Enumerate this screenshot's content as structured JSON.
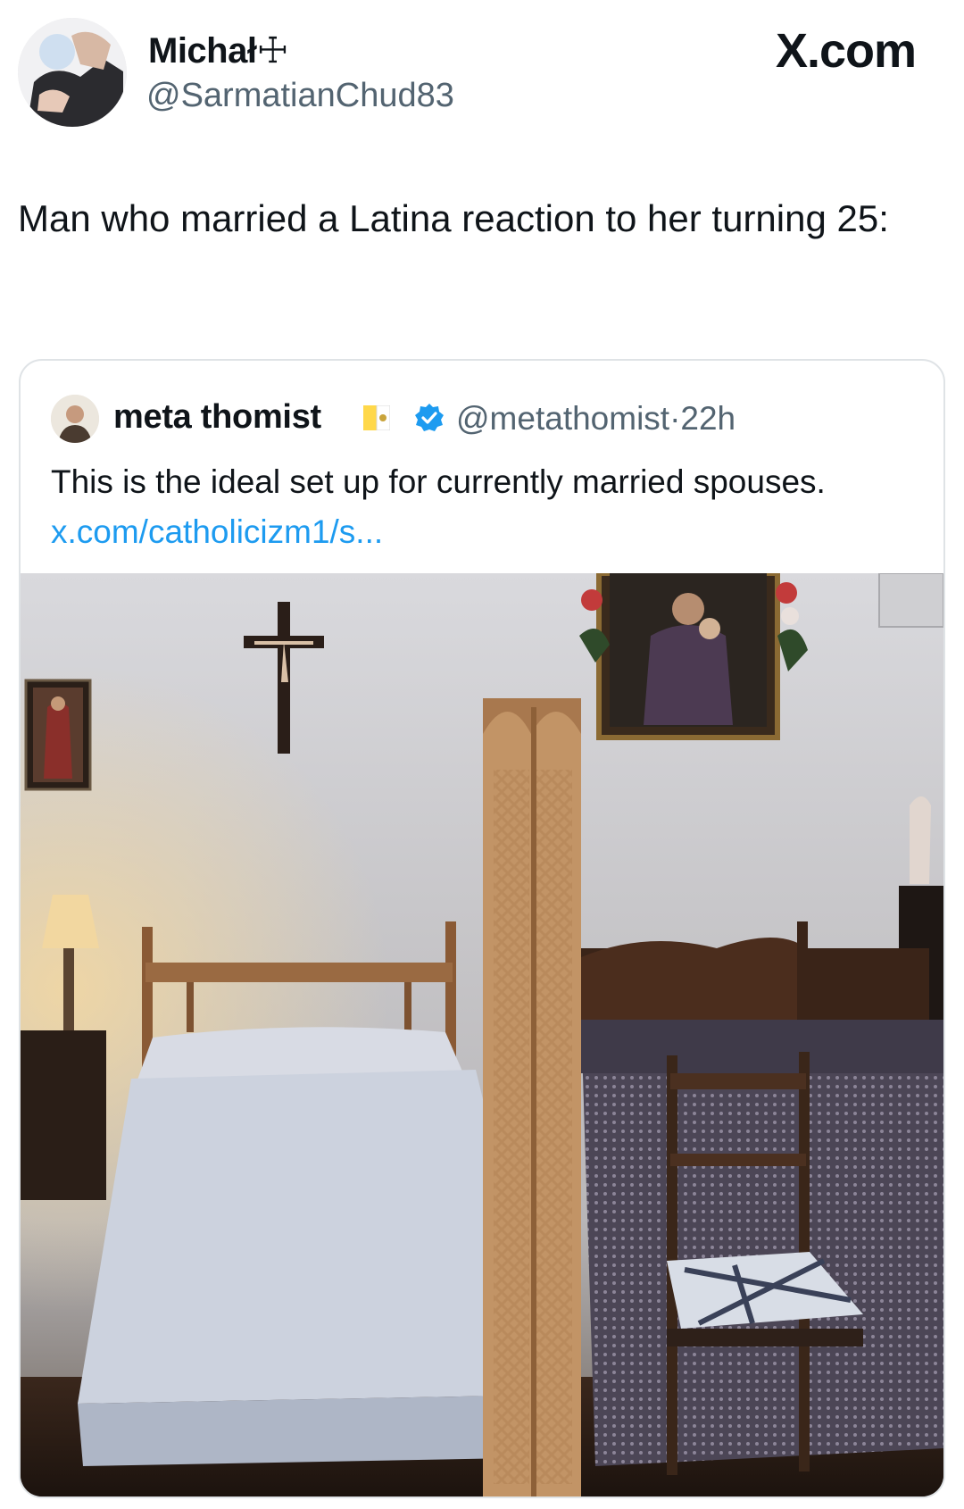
{
  "author": {
    "name": "Michał☩",
    "handle": "@SarmatianChud83"
  },
  "brand": "X.com",
  "tweet": {
    "text": "Man who married a Latina reaction to her turning 25:"
  },
  "quote": {
    "author_name": "meta thomist",
    "handle": "@metathomist",
    "separator": "·",
    "time": "22h",
    "text": "This is the ideal set up for currently married spouses.",
    "link_text": "x.com/catholicizm1/s..."
  },
  "icons": {
    "flag": "vatican-flag-icon",
    "verified": "verified-badge-icon"
  },
  "colors": {
    "link": "#1d9bf0",
    "verified": "#1d9bf0",
    "secondary_text": "#536471"
  }
}
